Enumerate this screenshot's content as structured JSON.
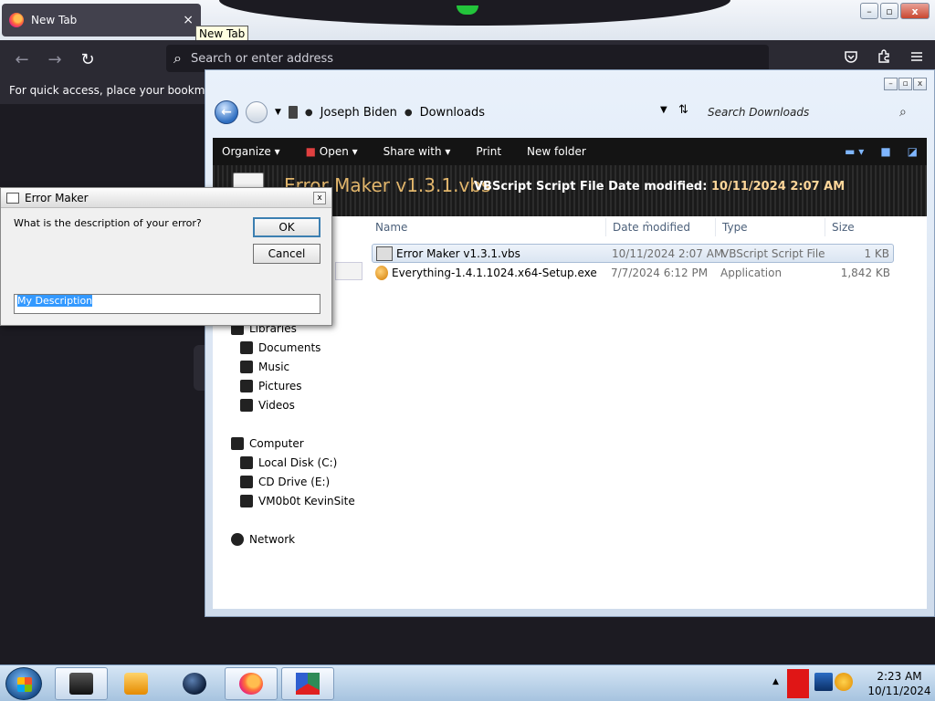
{
  "browser": {
    "tab_title": "New Tab",
    "tab_close": "×",
    "tooltip": "New Tab",
    "window_buttons": {
      "minimize": "–",
      "maximize": "▫",
      "close": "x"
    },
    "back": "←",
    "forward": "→",
    "reload": "↻",
    "address_placeholder": "Search or enter address",
    "search_glyph": "⌕",
    "toolbar_icons": [
      "pocket-icon",
      "extensions-icon",
      "menu-icon"
    ],
    "bookmarks_hint": "For quick access, place your bookmarks h"
  },
  "explorer": {
    "window_buttons": {
      "minimize": "–",
      "maximize": "▫",
      "close": "x"
    },
    "breadcrumb": [
      "Joseph Biden",
      "Downloads"
    ],
    "search_placeholder": "Search Downloads",
    "commands": [
      "Organize ▾",
      "Open ▾",
      "Share with ▾",
      "Print",
      "New folder"
    ],
    "details_header": {
      "file_name": "Error Maker v1.3.1.vbs",
      "file_type": "VBScript Script File",
      "date_label": "Date modified:",
      "date_value": "10/11/2024 2:07 AM"
    },
    "columns": [
      "Name",
      "Date modified",
      "Type",
      "Size"
    ],
    "files": [
      {
        "name": "Error Maker v1.3.1.vbs",
        "date": "10/11/2024 2:07 AM",
        "type": "VBScript Script File",
        "size": "1 KB",
        "selected": true
      },
      {
        "name": "Everything-1.4.1.1024.x64-Setup.exe",
        "date": "7/7/2024 6:12 PM",
        "type": "Application",
        "size": "1,842 KB",
        "selected": false
      }
    ],
    "nav": {
      "libraries": "Libraries",
      "library_items": [
        "Documents",
        "Music",
        "Pictures",
        "Videos"
      ],
      "computer": "Computer",
      "computer_items": [
        "Local Disk (C:)",
        "CD Drive (E:)",
        "VM0b0t KevinSite"
      ],
      "network": "Network"
    }
  },
  "dialog": {
    "title": "Error Maker",
    "close": "x",
    "prompt": "What is the description of your error?",
    "ok_label": "OK",
    "cancel_label": "Cancel",
    "input_value": "My Description"
  },
  "taskbar": {
    "pinned": [
      "terminal-icon",
      "media-player-icon",
      "globe-icon",
      "firefox-icon",
      "paint-icon"
    ],
    "clock_time": "2:23 AM",
    "clock_date": "10/11/2024"
  }
}
